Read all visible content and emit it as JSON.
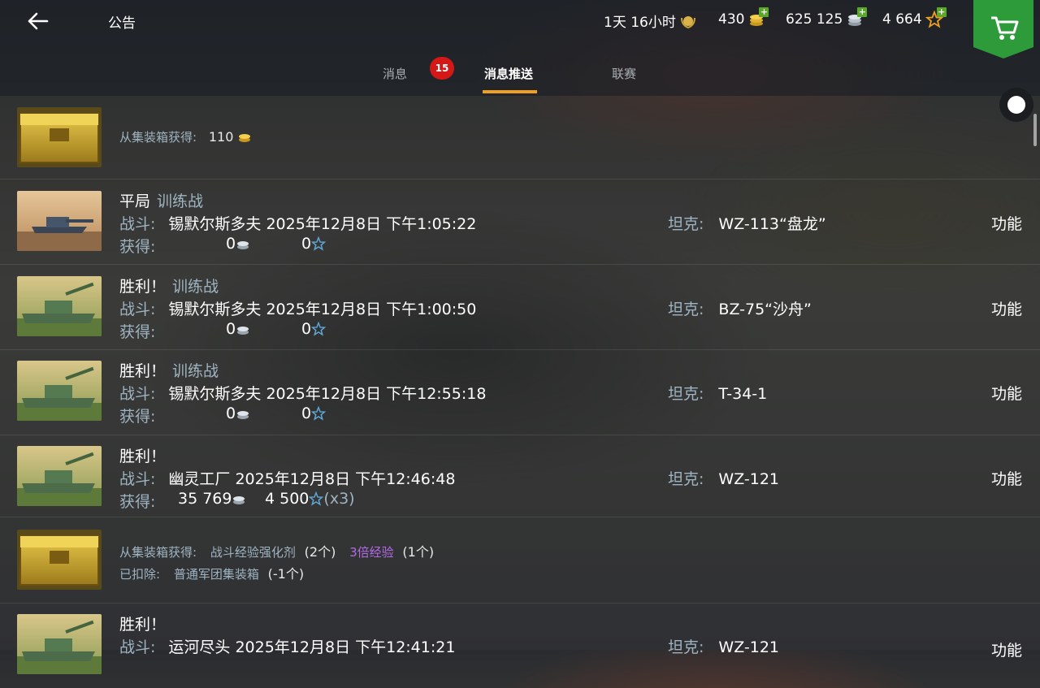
{
  "header": {
    "title": "公告",
    "timer": "1天 16小时",
    "gold": "430",
    "credits": "625 125",
    "free_xp": "4 664"
  },
  "tabs": [
    {
      "label": "消息",
      "badge": "15"
    },
    {
      "label": "消息推送",
      "active": true
    },
    {
      "label": "联赛"
    }
  ],
  "labels": {
    "battle": "战斗:",
    "earned": "获得:",
    "tank": "坦克:",
    "func": "功能",
    "crate_obtained": "从集装箱获得:",
    "deducted": "已扣除:"
  },
  "rows": [
    {
      "kind": "crate",
      "amount": "110"
    },
    {
      "kind": "battle",
      "result": "平局",
      "mode": "训练战",
      "battle": "锡默尔斯多夫 2025年12月8日 下午1:05:22",
      "credits": "0",
      "xp": "0",
      "tank": "WZ-113“盘龙”"
    },
    {
      "kind": "battle",
      "result": "胜利！",
      "mode": "训练战",
      "battle": "锡默尔斯多夫 2025年12月8日 下午1:00:50",
      "credits": "0",
      "xp": "0",
      "tank": "BZ-75“沙舟”"
    },
    {
      "kind": "battle",
      "result": "胜利！",
      "mode": "训练战",
      "battle": "锡默尔斯多夫 2025年12月8日 下午12:55:18",
      "credits": "0",
      "xp": "0",
      "tank": "T-34-1"
    },
    {
      "kind": "battle",
      "result": "胜利！",
      "mode": "",
      "battle": "幽灵工厂 2025年12月8日 下午12:46:48",
      "credits": "35 769",
      "xp": "4 500",
      "mult": "(x3)",
      "tank": "WZ-121"
    },
    {
      "kind": "crate2",
      "item1": "战斗经验强化剂",
      "item1_count": "(2个)",
      "item2": "3倍经验",
      "item2_count": "(1个)",
      "deducted_item": "普通军团集装箱",
      "deducted_count": "(-1个)"
    },
    {
      "kind": "battle",
      "result": "胜利！",
      "mode": "",
      "battle": "运河尽头 2025年12月8日 下午12:41:21",
      "tank": "WZ-121"
    }
  ],
  "colors": {
    "accent": "#f0a020",
    "badge": "#d41818",
    "shop": "#2e9b3a",
    "label": "#9fb4c2",
    "purple": "#b36be8"
  }
}
